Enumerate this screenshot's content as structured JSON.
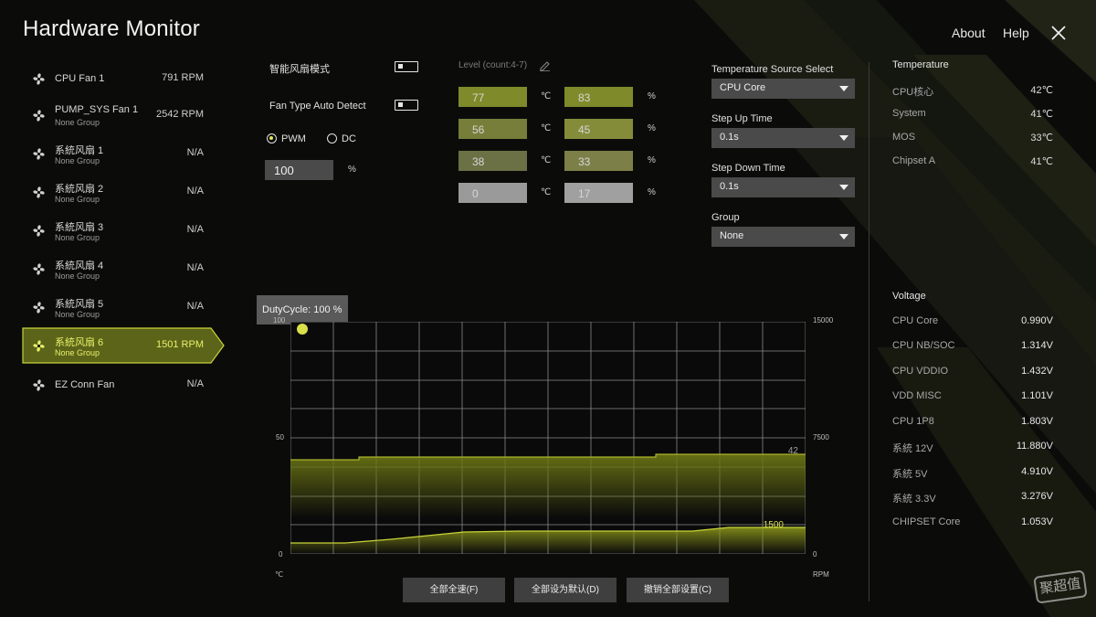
{
  "header": {
    "title": "Hardware Monitor",
    "about": "About",
    "help": "Help"
  },
  "fans": [
    {
      "name": "CPU Fan 1",
      "group": "",
      "value": "791 RPM",
      "selected": false
    },
    {
      "name": "PUMP_SYS Fan 1",
      "group": "None Group",
      "value": "2542 RPM",
      "selected": false
    },
    {
      "name": "系統风扇 1",
      "group": "None Group",
      "value": "N/A",
      "selected": false
    },
    {
      "name": "系統风扇 2",
      "group": "None Group",
      "value": "N/A",
      "selected": false
    },
    {
      "name": "系統风扇 3",
      "group": "None Group",
      "value": "N/A",
      "selected": false
    },
    {
      "name": "系統风扇 4",
      "group": "None Group",
      "value": "N/A",
      "selected": false
    },
    {
      "name": "系統风扇 5",
      "group": "None Group",
      "value": "N/A",
      "selected": false
    },
    {
      "name": "系統风扇 6",
      "group": "None Group",
      "value": "1501 RPM",
      "selected": true
    },
    {
      "name": "EZ Conn Fan",
      "group": "",
      "value": "N/A",
      "selected": false
    }
  ],
  "controls": {
    "smart_fan_label": "智能风扇模式",
    "auto_detect_label": "Fan Type Auto Detect",
    "pwm_label": "PWM",
    "dc_label": "DC",
    "duty_value": "100",
    "duty_unit": "%",
    "level_label": "Level (count:4-7)",
    "temp_unit": "℃",
    "pct_unit": "%",
    "levels": [
      {
        "temp": "77",
        "pct": "83",
        "temp_color": "#7f8a2a",
        "pct_color": "#7f8a2a"
      },
      {
        "temp": "56",
        "pct": "45",
        "temp_color": "#767e3a",
        "pct_color": "#848c3a"
      },
      {
        "temp": "38",
        "pct": "33",
        "temp_color": "#6c7045",
        "pct_color": "#7c8048"
      },
      {
        "temp": "0",
        "pct": "17",
        "temp_color": "#9a9a9a",
        "pct_color": "#a0a0a0"
      }
    ]
  },
  "dropdowns": {
    "source_label": "Temperature Source Select",
    "source_value": "CPU Core",
    "stepup_label": "Step Up Time",
    "stepup_value": "0.1s",
    "stepdown_label": "Step Down Time",
    "stepdown_value": "0.1s",
    "group_label": "Group",
    "group_value": "None"
  },
  "temperature": {
    "title": "Temperature",
    "items": [
      {
        "label": "CPU核心",
        "value": "42℃"
      },
      {
        "label": "System",
        "value": "41℃"
      },
      {
        "label": "MOS",
        "value": "33℃"
      },
      {
        "label": "Chipset A",
        "value": "41℃"
      }
    ]
  },
  "voltage": {
    "title": "Voltage",
    "items": [
      {
        "label": "CPU Core",
        "value": "0.990V"
      },
      {
        "label": "CPU NB/SOC",
        "value": "1.314V"
      },
      {
        "label": "CPU VDDIO",
        "value": "1.432V"
      },
      {
        "label": "VDD MISC",
        "value": "1.101V"
      },
      {
        "label": "CPU 1P8",
        "value": "1.803V"
      },
      {
        "label": "系統 12V",
        "value": "11.880V"
      },
      {
        "label": "系統 5V",
        "value": "4.910V"
      },
      {
        "label": "系統 3.3V",
        "value": "3.276V"
      },
      {
        "label": "CHIPSET Core",
        "value": "1.053V"
      }
    ]
  },
  "chart": {
    "duty_tag": "DutyCycle: 100 %",
    "left_ticks": [
      "100",
      "50",
      "0"
    ],
    "right_ticks": [
      "15000",
      "7500",
      "0"
    ],
    "left_unit": "℃",
    "right_unit": "RPM",
    "temp_readout": "42",
    "rpm_readout": "1500",
    "accent": "#d9e04a"
  },
  "buttons": {
    "full_speed": "全部全速(F)",
    "default": "全部设为默认(D)",
    "revert": "撤销全部设置(C)"
  },
  "watermark": "聚超值",
  "colors": {
    "accent": "#dfe65a",
    "selected_bg": "#5b6418"
  }
}
